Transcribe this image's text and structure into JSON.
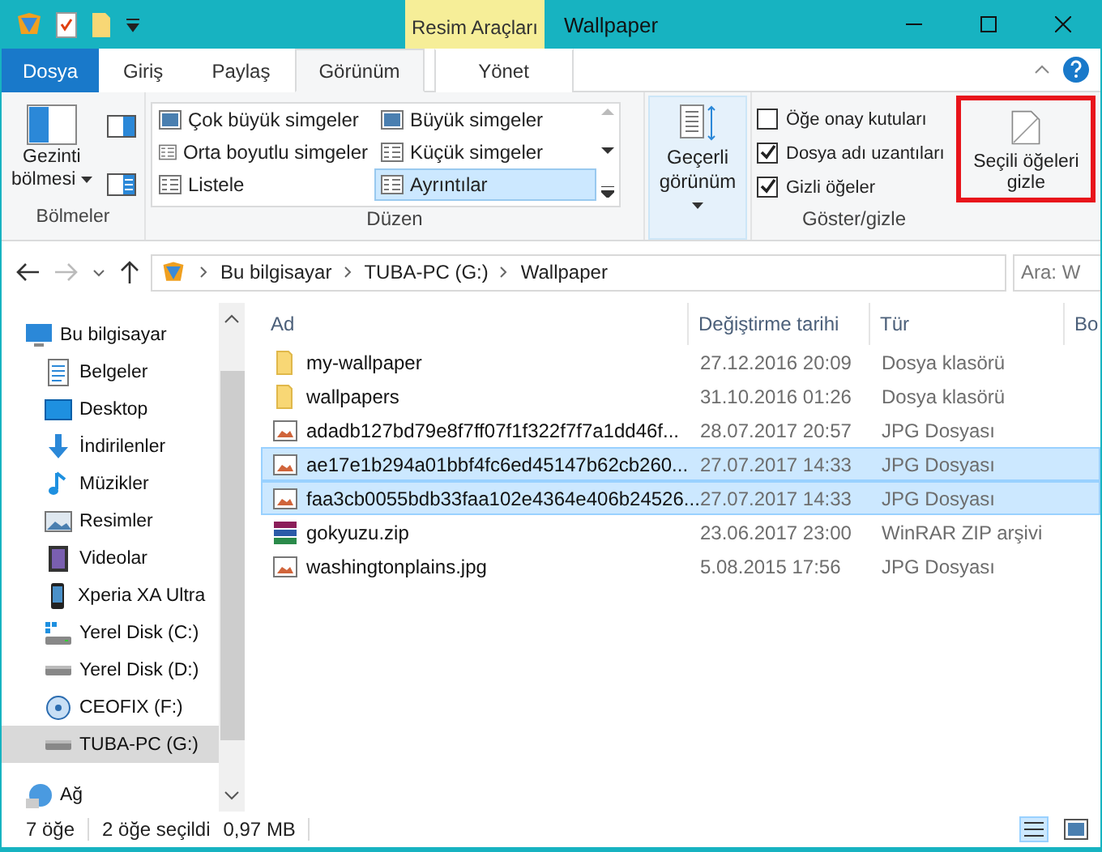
{
  "title_bar": {
    "context_tab": "Resim Araçları",
    "title": "Wallpaper"
  },
  "ribbon_tabs": [
    {
      "label": "Dosya",
      "kind": "file",
      "selected": false
    },
    {
      "label": "Giriş",
      "kind": "normal",
      "selected": false
    },
    {
      "label": "Paylaş",
      "kind": "normal",
      "selected": false
    },
    {
      "label": "Görünüm",
      "kind": "normal",
      "selected": true
    },
    {
      "label": "Yönet",
      "kind": "context",
      "selected": false
    }
  ],
  "panes_group": {
    "button": "Gezinti bölmesi",
    "label": "Bölmeler"
  },
  "layout_group": {
    "options": [
      {
        "label": "Çok büyük simgeler",
        "selected": false
      },
      {
        "label": "Büyük simgeler",
        "selected": false
      },
      {
        "label": "Orta boyutlu simgeler",
        "selected": false
      },
      {
        "label": "Küçük simgeler",
        "selected": false
      },
      {
        "label": "Listele",
        "selected": false
      },
      {
        "label": "Ayrıntılar",
        "selected": true
      }
    ],
    "label": "Düzen"
  },
  "current_view": {
    "button": "Geçerli görünüm"
  },
  "show_hide_group": {
    "checkboxes": [
      {
        "label": "Öğe onay kutuları",
        "checked": false
      },
      {
        "label": "Dosya adı uzantıları",
        "checked": true
      },
      {
        "label": "Gizli öğeler",
        "checked": true
      }
    ],
    "hide_button": "Seçili öğeleri gizle",
    "highlighted": true,
    "label": "Göster/gizle"
  },
  "address": {
    "breadcrumbs": [
      "Bu bilgisayar",
      "TUBA-PC (G:)",
      "Wallpaper"
    ],
    "search_placeholder": "Ara: W"
  },
  "nav_items": [
    {
      "label": "Bu bilgisayar",
      "kind": "computer",
      "selected": false
    },
    {
      "label": "Belgeler",
      "kind": "document",
      "selected": false
    },
    {
      "label": "Desktop",
      "kind": "desktop",
      "selected": false
    },
    {
      "label": "İndirilenler",
      "kind": "download",
      "selected": false
    },
    {
      "label": "Müzikler",
      "kind": "music",
      "selected": false
    },
    {
      "label": "Resimler",
      "kind": "pictures",
      "selected": false
    },
    {
      "label": "Videolar",
      "kind": "video",
      "selected": false
    },
    {
      "label": "Xperia XA Ultra",
      "kind": "phone",
      "selected": false
    },
    {
      "label": "Yerel Disk (C:)",
      "kind": "windisk",
      "selected": false
    },
    {
      "label": "Yerel Disk (D:)",
      "kind": "disk",
      "selected": false
    },
    {
      "label": "CEOFIX (F:)",
      "kind": "cd",
      "selected": false
    },
    {
      "label": "TUBA-PC (G:)",
      "kind": "disk",
      "selected": true
    },
    {
      "label": "Ağ",
      "kind": "network",
      "selected": false
    }
  ],
  "columns": [
    "Ad",
    "Değiştirme tarihi",
    "Tür",
    "Bo"
  ],
  "rows": [
    {
      "name": "my-wallpaper",
      "date": "27.12.2016 20:09",
      "type": "Dosya klasörü",
      "kind": "folder",
      "selected": false
    },
    {
      "name": "wallpapers",
      "date": "31.10.2016 01:26",
      "type": "Dosya klasörü",
      "kind": "folder",
      "selected": false
    },
    {
      "name": "adadb127bd79e8f7ff07f1f322f7f7a1dd46f...",
      "date": "28.07.2017 20:57",
      "type": "JPG Dosyası",
      "kind": "image",
      "selected": false
    },
    {
      "name": "ae17e1b294a01bbf4fc6ed45147b62cb260...",
      "date": "27.07.2017 14:33",
      "type": "JPG Dosyası",
      "kind": "image",
      "selected": true
    },
    {
      "name": "faa3cb0055bdb33faa102e4364e406b24526...",
      "date": "27.07.2017 14:33",
      "type": "JPG Dosyası",
      "kind": "image",
      "selected": true
    },
    {
      "name": "gokyuzu.zip",
      "date": "23.06.2017 23:00",
      "type": "WinRAR ZIP arşivi",
      "kind": "zip",
      "selected": false
    },
    {
      "name": "washingtonplains.jpg",
      "date": "5.08.2015 17:56",
      "type": "JPG Dosyası",
      "kind": "image",
      "selected": false
    }
  ],
  "status_bar": {
    "count": "7 öğe",
    "selection": "2 öğe seçildi",
    "size": "0,97 MB"
  }
}
